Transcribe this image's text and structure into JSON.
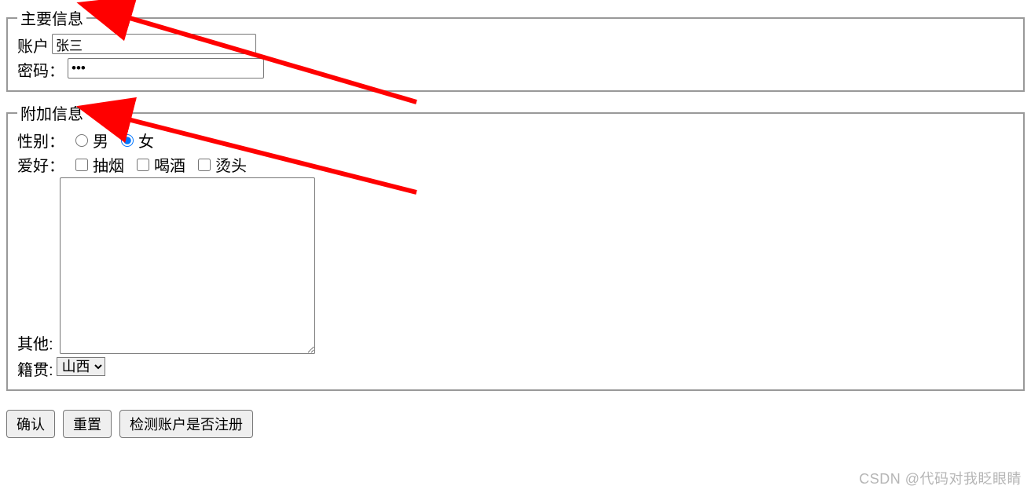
{
  "fieldset1": {
    "legend": "主要信息",
    "account": {
      "label": "账户 ",
      "value": "张三"
    },
    "password": {
      "label": "密码：",
      "value": "•••"
    }
  },
  "fieldset2": {
    "legend": "附加信息",
    "gender": {
      "label": "性别：",
      "options": {
        "male": "男",
        "female": "女"
      },
      "selected": "female"
    },
    "hobby": {
      "label": "爱好：",
      "options": {
        "smoke": "抽烟",
        "drink": "喝酒",
        "perm": "烫头"
      }
    },
    "other": {
      "label": "其他:",
      "value": ""
    },
    "origin": {
      "label": "籍贯:",
      "selected": "山西"
    }
  },
  "buttons": {
    "confirm": "确认",
    "reset": "重置",
    "check": "检测账户是否注册"
  },
  "watermark": "CSDN @代码对我眨眼睛"
}
